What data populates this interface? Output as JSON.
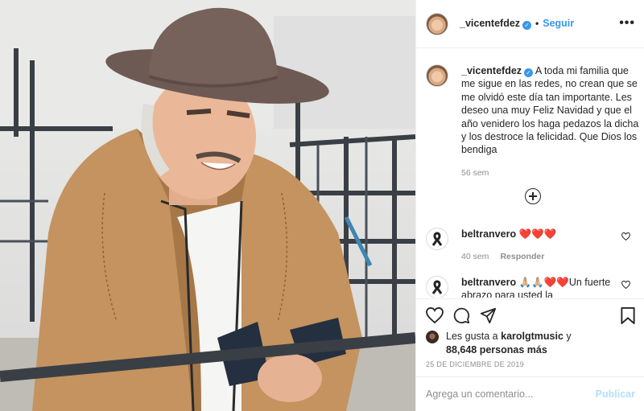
{
  "header": {
    "username": "_vicentefdez",
    "separator": "•",
    "follow_label": "Seguir",
    "more_label": "•••"
  },
  "caption": {
    "username": "_vicentefdez",
    "text": "A toda mi familia que me sigue en las redes, no crean que se me olvidó este día tan importante. Les deseo una muy Feliz Navidad y que el año venidero los haga pedazos la dicha y los destroce la felicidad. Que Dios los bendiga",
    "time": "56 sem"
  },
  "comments": [
    {
      "username": "beltranvero",
      "text": "❤️❤️❤️",
      "time": "40 sem",
      "reply_label": "Responder"
    },
    {
      "username": "beltranvero",
      "text": "🙏🏼🙏🏼❤️❤️Un fuerte abrazo para usted la"
    }
  ],
  "likes": {
    "prefix": "Les gusta a",
    "liker": "karolgtmusic",
    "suffix": "y",
    "count_text": "88,648 personas más"
  },
  "date": "25 DE DICIEMBRE DE 2019",
  "add_comment": {
    "placeholder": "Agrega un comentario...",
    "publish_label": "Publicar"
  },
  "colors": {
    "accent": "#3897f0",
    "publish_disabled": "#b2dffc",
    "like_red": "#ed4956",
    "jacket": "#c4935f",
    "hat": "#6e5a54"
  },
  "icons": [
    "verified-badge-icon",
    "more-options-icon",
    "add-circle-icon",
    "ribbon-icon",
    "heart-icon",
    "comment-icon",
    "share-icon",
    "bookmark-icon"
  ]
}
